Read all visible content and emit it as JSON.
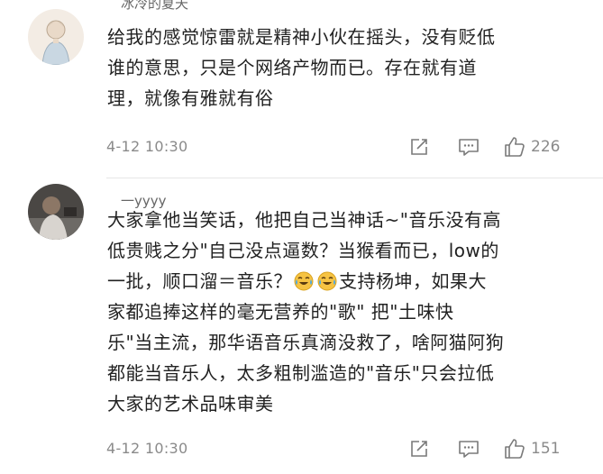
{
  "comments": [
    {
      "username": "冰冷的夏天",
      "content_lines": [
        "给我的感觉惊雷就是精神小伙在摇头，没有贬低",
        "谁的意思，只是个网络产物而已。存在就有道",
        "理，就像有雅就有俗"
      ],
      "timestamp": "4-12 10:30",
      "like_count": "226",
      "forward_icon": "share-edit-icon",
      "reply_icon": "comment-bubble-icon",
      "like_icon": "thumbs-up-icon"
    },
    {
      "username": "一yyyy",
      "content_lines": [
        "大家拿他当笑话，他把自己当神话~\"音乐没有高",
        "低贵贱之分\"自己没点逼数？当猴看而已，low的",
        "一批，顺口溜＝音乐？",
        "支持杨坤，如果大",
        "家都追捧这样的毫无营养的\"歌\"  把\"土味快",
        "乐\"当主流，那华语音乐真滴没救了，啥阿猫阿狗",
        "都能当音乐人，太多粗制滥造的\"音乐\"只会拉低",
        "大家的艺术品味审美"
      ],
      "emoji_name": "laughing-crying-emoji",
      "timestamp": "4-12 10:30",
      "like_count": "151",
      "forward_icon": "share-edit-icon",
      "reply_icon": "comment-bubble-icon",
      "like_icon": "thumbs-up-icon"
    }
  ],
  "colors": {
    "text_primary": "#222222",
    "text_secondary": "#8a8a8a",
    "divider": "#e6e6e6",
    "background": "#ffffff"
  }
}
